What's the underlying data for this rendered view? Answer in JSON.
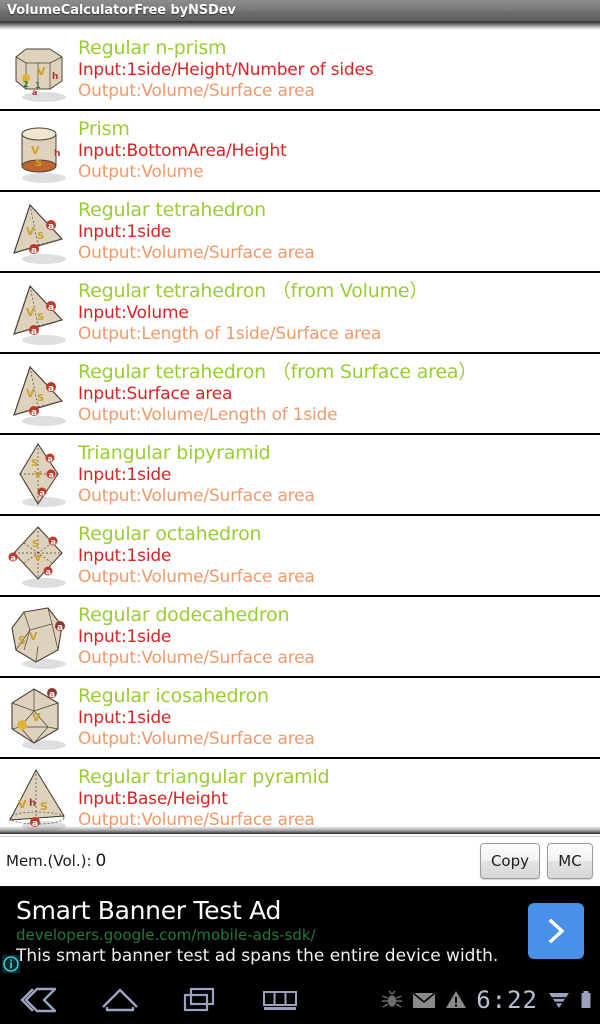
{
  "titlebar": {
    "title": "VolumeCalculatorFree byNSDev"
  },
  "list": {
    "rows": [
      {
        "name": "Regular n-prism",
        "input": "Input:1side/Height/Number of sides",
        "output": "Output:Volume/Surface area",
        "icon": "n-prism-shape-icon"
      },
      {
        "name": "Prism",
        "input": "Input:BottomArea/Height",
        "output": "Output:Volume",
        "icon": "prism-shape-icon"
      },
      {
        "name": "Regular tetrahedron",
        "input": "Input:1side",
        "output": "Output:Volume/Surface area",
        "icon": "tetrahedron-shape-icon"
      },
      {
        "name": "Regular tetrahedron （from Volume）",
        "input": "Input:Volume",
        "output": "Output:Length of 1side/Surface area",
        "icon": "tetrahedron-shape-icon"
      },
      {
        "name": "Regular tetrahedron （from Surface area）",
        "input": "Input:Surface area",
        "output": "Output:Volume/Length of 1side",
        "icon": "tetrahedron-shape-icon"
      },
      {
        "name": "Triangular bipyramid",
        "input": "Input:1side",
        "output": "Output:Volume/Surface area",
        "icon": "bipyramid-shape-icon"
      },
      {
        "name": "Regular octahedron",
        "input": "Input:1side",
        "output": "Output:Volume/Surface area",
        "icon": "octahedron-shape-icon"
      },
      {
        "name": "Regular dodecahedron",
        "input": "Input:1side",
        "output": "Output:Volume/Surface area",
        "icon": "dodecahedron-shape-icon"
      },
      {
        "name": "Regular icosahedron",
        "input": "Input:1side",
        "output": "Output:Volume/Surface area",
        "icon": "icosahedron-shape-icon"
      },
      {
        "name": "Regular triangular pyramid",
        "input": "Input:Base/Height",
        "output": "Output:Volume/Surface area",
        "icon": "triangular-pyramid-shape-icon"
      }
    ]
  },
  "membar": {
    "label": "Mem.(Vol.):",
    "value": "0",
    "copy_label": "Copy",
    "mc_label": "MC"
  },
  "ad": {
    "headline": "Smart Banner Test Ad",
    "url": "developers.google.com/mobile-ads-sdk/",
    "description": "This smart banner test ad spans the entire device width.",
    "cta_icon": "chevron-right-icon",
    "info_icon": "ad-info-icon"
  },
  "navbar": {
    "back_icon": "back-icon",
    "home_icon": "home-icon",
    "recents_icon": "recent-apps-icon",
    "menu_icon": "menu-grid-icon",
    "debug_icon": "android-debug-bug-icon",
    "mail_icon": "mail-envelope-icon",
    "warning_icon": "warning-triangle-icon",
    "clock": "6:22",
    "signal_icon": "signal-strength-icon",
    "battery_icon": "battery-icon"
  },
  "colors": {
    "title_green": "#9acd32",
    "input_red": "#dd2222",
    "output_orange": "#f0996a",
    "ad_cta_blue": "#4a90e8",
    "ad_url_green": "#1f7a3d",
    "titlebar_gray": "#7b7b7b"
  }
}
